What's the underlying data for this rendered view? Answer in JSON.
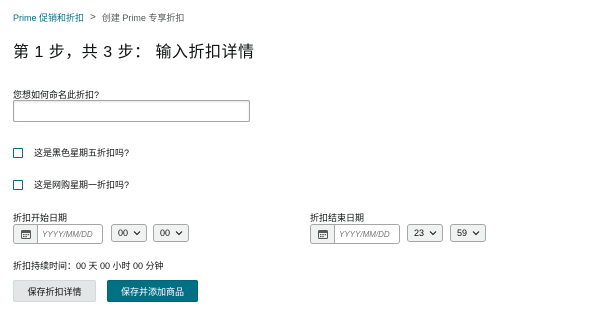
{
  "breadcrumb": {
    "parent": "Prime 促销和折扣",
    "separator": ">",
    "current": "创建 Prime 专享折扣"
  },
  "page_title": "第 1 步，共 3 步： 输入折扣详情",
  "name_field": {
    "label": "您想如何命名此折扣?",
    "value": "",
    "placeholder": ""
  },
  "checkboxes": [
    {
      "label": "这是黑色星期五折扣吗?",
      "checked": false
    },
    {
      "label": "这是网购星期一折扣吗?",
      "checked": false
    }
  ],
  "start_date": {
    "label": "折扣开始日期",
    "date_placeholder": "YYYY/MM/DD",
    "hour": "00",
    "minute": "00",
    "icon": "calendar-icon"
  },
  "end_date": {
    "label": "折扣结束日期",
    "date_placeholder": "YYYY/MM/DD",
    "hour": "23",
    "minute": "59",
    "icon": "calendar-icon"
  },
  "duration_text": "折扣持续时间：00 天 00 小时 00 分钟",
  "buttons": {
    "save": "保存折扣详情",
    "save_add": "保存并添加商品"
  },
  "colors": {
    "link": "#007185",
    "primary_button": "#007185",
    "secondary_button": "#e3e6e6"
  }
}
